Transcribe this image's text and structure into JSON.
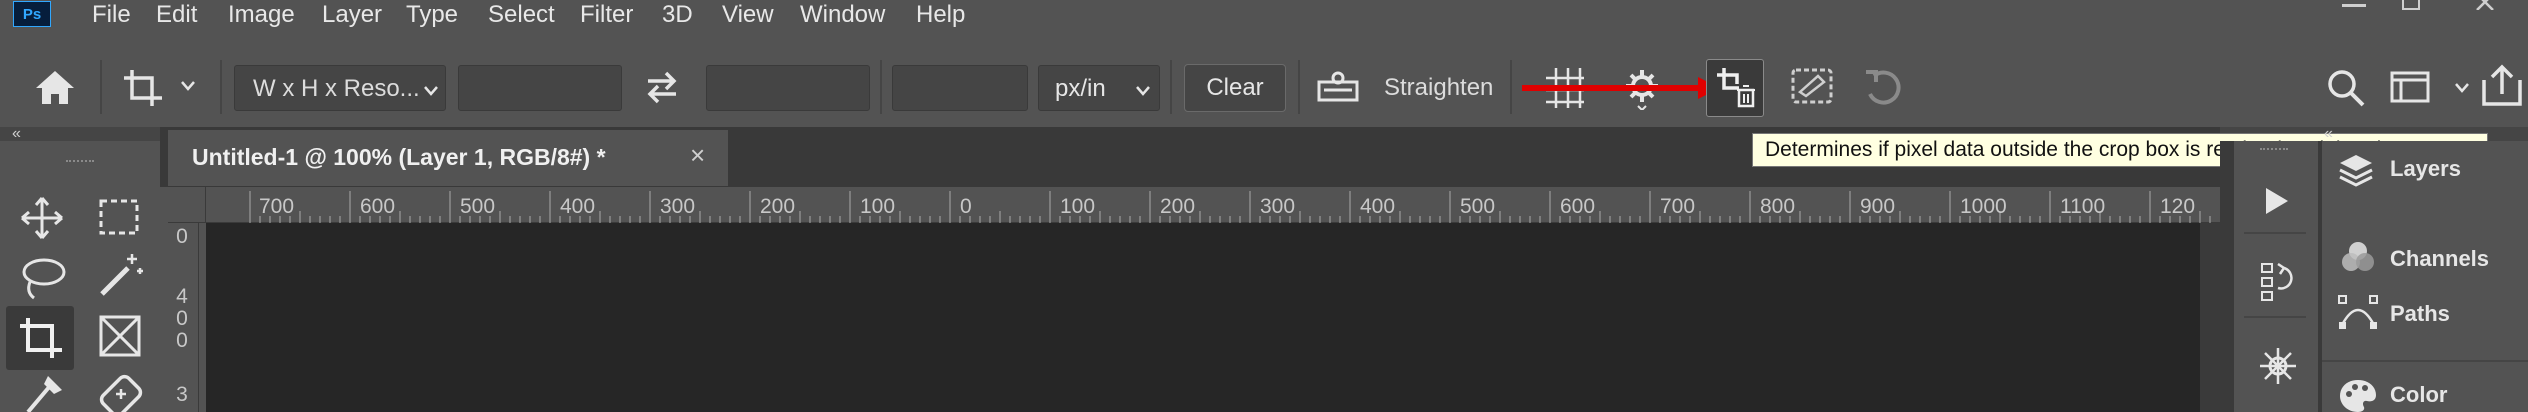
{
  "app": {
    "logo": "Ps"
  },
  "menu": {
    "items": [
      "File",
      "Edit",
      "Image",
      "Layer",
      "Type",
      "Select",
      "Filter",
      "3D",
      "View",
      "Window",
      "Help"
    ]
  },
  "options_bar": {
    "ratio_preset": "W x H x Reso...",
    "width_value": "",
    "height_value": "",
    "resolution_value": "",
    "resolution_unit": "px/in",
    "clear_label": "Clear",
    "straighten_label": "Straighten"
  },
  "tooltip": {
    "text": "Determines if pixel data outside the crop box is retained or deleted"
  },
  "document": {
    "tab_title": "Untitled-1 @ 100% (Layer 1, RGB/8#) *",
    "close_glyph": "×"
  },
  "rulers": {
    "top_labels": [
      "700",
      "600",
      "500",
      "400",
      "300",
      "200",
      "100",
      "0",
      "100",
      "200",
      "300",
      "400",
      "500",
      "600",
      "700",
      "800",
      "900",
      "1000",
      "1100",
      "120"
    ],
    "left_labels": [
      "0",
      "4",
      "0",
      "0",
      "3"
    ]
  },
  "panels": {
    "items": [
      "Layers",
      "Channels",
      "Paths",
      "Color"
    ]
  },
  "colors": {
    "annotation_arrow": "#e00000",
    "tooltip_bg": "#ffffe1",
    "ps_blue": "#31a8ff"
  }
}
